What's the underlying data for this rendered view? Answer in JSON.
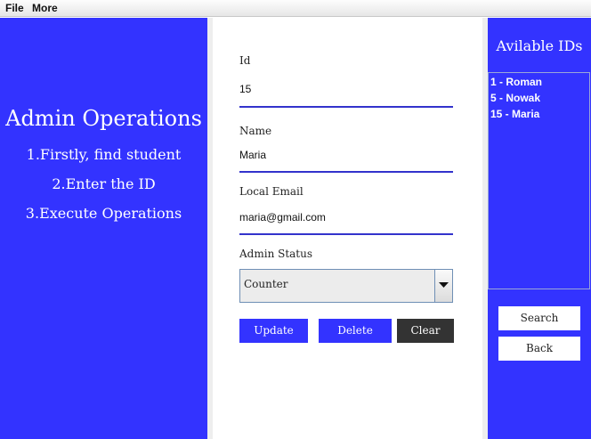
{
  "menubar": {
    "items": [
      {
        "label": "File"
      },
      {
        "label": "More"
      }
    ]
  },
  "left_panel": {
    "title": "Admin Operations",
    "steps": [
      "1.Firstly, find student",
      "2.Enter the ID",
      "3.Execute Operations"
    ]
  },
  "form": {
    "id": {
      "label": "Id",
      "value": "15"
    },
    "name": {
      "label": "Name",
      "value": "Maria"
    },
    "email": {
      "label": "Local Email",
      "value": "maria@gmail.com"
    },
    "admin_status": {
      "label": "Admin Status",
      "selected": "Counter"
    },
    "buttons": {
      "update": "Update",
      "delete": "Delete",
      "clear": "Clear"
    }
  },
  "right_panel": {
    "title": "Avilable IDs",
    "ids": [
      "1 - Roman",
      "5 - Nowak",
      "15 - Maria"
    ],
    "buttons": {
      "search": "Search",
      "back": "Back"
    }
  },
  "colors": {
    "accent": "#3333ff",
    "underline": "#3333cc",
    "clear_button": "#333333",
    "divider": "#eeeeee"
  },
  "icons": {
    "select_arrow": "chevron-down-icon"
  }
}
